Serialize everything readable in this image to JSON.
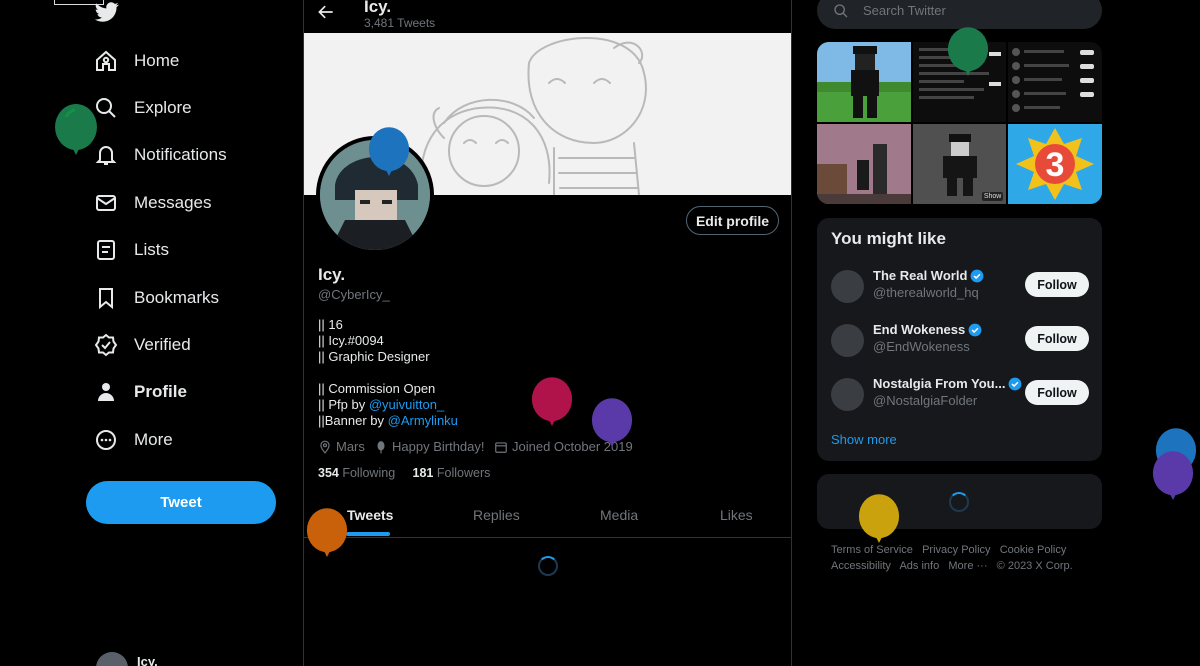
{
  "nav": {
    "items": [
      {
        "label": "Home",
        "icon": "home-icon"
      },
      {
        "label": "Explore",
        "icon": "search-icon"
      },
      {
        "label": "Notifications",
        "icon": "bell-icon"
      },
      {
        "label": "Messages",
        "icon": "mail-icon"
      },
      {
        "label": "Lists",
        "icon": "list-icon"
      },
      {
        "label": "Bookmarks",
        "icon": "bookmark-icon"
      },
      {
        "label": "Verified",
        "icon": "verified-icon"
      },
      {
        "label": "Profile",
        "icon": "person-icon"
      },
      {
        "label": "More",
        "icon": "more-circle-icon"
      }
    ],
    "tweet_button": "Tweet",
    "account_name": "Icy."
  },
  "header": {
    "name": "Icy.",
    "tweet_count": "3,481 Tweets"
  },
  "profile": {
    "edit_button": "Edit profile",
    "name": "Icy.",
    "handle": "@CyberIcy_",
    "bio": {
      "line1": "|| 16",
      "line2": "|| Icy.#0094",
      "line3": "|| Graphic Designer",
      "line4": "|| Commission Open",
      "line5_prefix": "|| Pfp by ",
      "line5_link": "@yuivuitton_",
      "line6_prefix": "||Banner by ",
      "line6_link": "@Armylinku"
    },
    "location": "Mars",
    "birthday": "Happy Birthday!",
    "joined": "Joined October 2019",
    "following_count": "354",
    "following_label": "Following",
    "followers_count": "181",
    "followers_label": "Followers"
  },
  "tabs": [
    "Tweets",
    "Replies",
    "Media",
    "Likes"
  ],
  "search": {
    "placeholder": "Search Twitter"
  },
  "who_to_follow": {
    "title": "You might like",
    "accounts": [
      {
        "name": "The Real World",
        "handle": "@therealworld_hq",
        "button": "Follow"
      },
      {
        "name": "End Wokeness",
        "handle": "@EndWokeness",
        "button": "Follow"
      },
      {
        "name": "Nostalgia From You...",
        "handle": "@NostalgiaFolder",
        "button": "Follow"
      }
    ],
    "show_more": "Show more"
  },
  "footer": {
    "terms": "Terms of Service",
    "privacy": "Privacy Policy",
    "cookie": "Cookie Policy",
    "accessibility": "Accessibility",
    "ads": "Ads info",
    "more": "More ···",
    "copyright": "© 2023 X Corp."
  },
  "media_grid": {
    "item5_badge": "Show",
    "item6_badge_number": "3"
  },
  "colors": {
    "accent": "#1d9bf0",
    "background": "#000000",
    "panel": "#16181c"
  }
}
